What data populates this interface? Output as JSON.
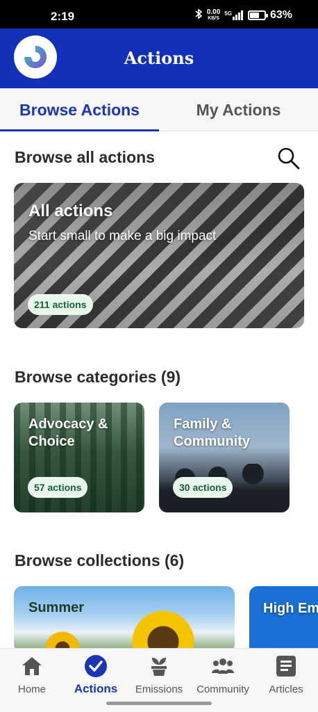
{
  "status_bar": {
    "time": "2:19",
    "net_speed_value": "0.00",
    "net_speed_unit": "KB/S",
    "network": "5G",
    "battery_percent": "63%",
    "battery_level": 0.63
  },
  "header": {
    "title": "Actions",
    "brand_color": "#1330b8"
  },
  "tabs": [
    {
      "label": "Browse Actions",
      "active": true
    },
    {
      "label": "My Actions",
      "active": false
    }
  ],
  "browse_all": {
    "title": "Browse all actions",
    "card": {
      "title": "All actions",
      "subtitle": "Start small to make a big impact",
      "count": "211 actions"
    }
  },
  "categories": {
    "title": "Browse categories (9)",
    "items": [
      {
        "title": "Advocacy & Choice",
        "count": "57 actions"
      },
      {
        "title": "Family & Community",
        "count": "30 actions"
      }
    ]
  },
  "collections": {
    "title": "Browse collections (6)",
    "items": [
      {
        "title": "Summer"
      },
      {
        "title": "High Emiss"
      }
    ]
  },
  "bottom_nav": [
    {
      "label": "Home",
      "icon": "home-icon"
    },
    {
      "label": "Actions",
      "icon": "checkmark-circle-icon",
      "active": true
    },
    {
      "label": "Emissions",
      "icon": "plant-icon"
    },
    {
      "label": "Community",
      "icon": "people-icon"
    },
    {
      "label": "Articles",
      "icon": "article-icon"
    }
  ],
  "colors": {
    "accent": "#1a35b5",
    "pill_bg": "#e8f6ec",
    "pill_text": "#15623a"
  }
}
